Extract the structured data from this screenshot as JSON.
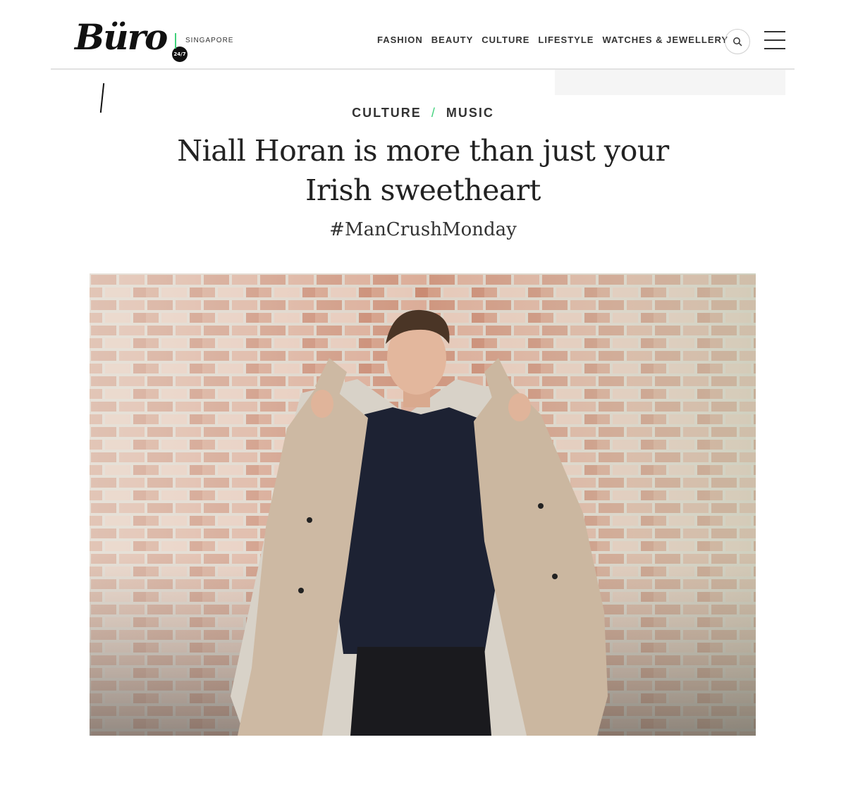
{
  "header": {
    "logo_text": "Büro",
    "logo_badge": "24/7",
    "edition": "SINGAPORE",
    "nav": [
      {
        "label": "FASHION"
      },
      {
        "label": "BEAUTY"
      },
      {
        "label": "CULTURE"
      },
      {
        "label": "LIFESTYLE"
      },
      {
        "label": "WATCHES & JEWELLERY"
      }
    ],
    "search_icon": "search-icon",
    "menu_icon": "hamburger-menu-icon"
  },
  "article": {
    "category": "CULTURE",
    "separator": "/",
    "subcategory": "MUSIC",
    "title": "Niall Horan is more than just your Irish sweetheart",
    "subtitle": "#ManCrushMonday"
  },
  "theme": {
    "accent": "#3fd17a",
    "text": "#222222",
    "divider": "#e2e2e2"
  }
}
